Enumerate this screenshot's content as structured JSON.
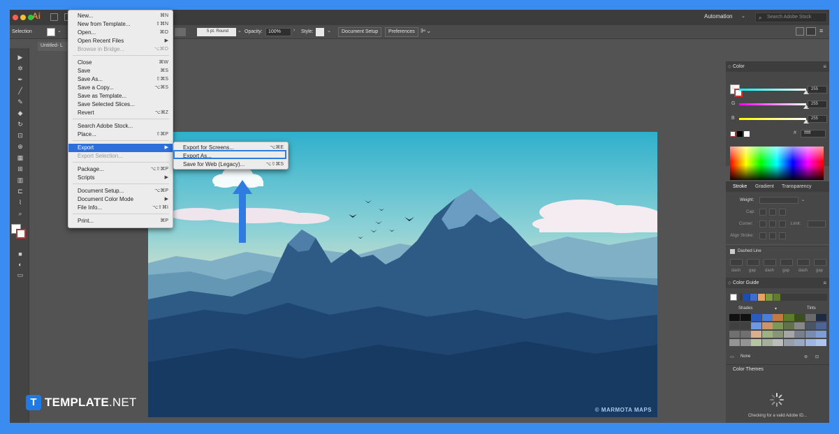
{
  "app": {
    "logo": "Ai",
    "workspace": "Automation",
    "search_placeholder": "Search Adobe Stock"
  },
  "control_bar": {
    "selection_label": "Selection",
    "brush": "5 pt. Round",
    "opacity_label": "Opacity:",
    "opacity_value": "100%",
    "style_label": "Style:",
    "document_setup": "Document Setup",
    "preferences": "Preferences"
  },
  "doc_tab": "Untitled- L",
  "file_menu": {
    "items": [
      {
        "label": "New...",
        "shortcut": "⌘N"
      },
      {
        "label": "New from Template...",
        "shortcut": "⇧⌘N"
      },
      {
        "label": "Open...",
        "shortcut": "⌘O"
      },
      {
        "label": "Open Recent Files",
        "shortcut": "▶"
      },
      {
        "label": "Browse in Bridge...",
        "shortcut": "⌥⌘O"
      },
      {
        "label": "Close",
        "shortcut": "⌘W"
      },
      {
        "label": "Save",
        "shortcut": "⌘S"
      },
      {
        "label": "Save As...",
        "shortcut": "⇧⌘S"
      },
      {
        "label": "Save a Copy...",
        "shortcut": "⌥⌘S"
      },
      {
        "label": "Save as Template...",
        "shortcut": ""
      },
      {
        "label": "Save Selected Slices...",
        "shortcut": ""
      },
      {
        "label": "Revert",
        "shortcut": "⌥⌘Z"
      },
      {
        "label": "Search Adobe Stock...",
        "shortcut": ""
      },
      {
        "label": "Place...",
        "shortcut": "⇧⌘P"
      },
      {
        "label": "Export",
        "shortcut": "▶"
      },
      {
        "label": "Export Selection...",
        "shortcut": ""
      },
      {
        "label": "Package...",
        "shortcut": "⌥⇧⌘P"
      },
      {
        "label": "Scripts",
        "shortcut": "▶"
      },
      {
        "label": "Document Setup...",
        "shortcut": "⌥⌘P"
      },
      {
        "label": "Document Color Mode",
        "shortcut": "▶"
      },
      {
        "label": "File Info...",
        "shortcut": "⌥⇧⌘I"
      },
      {
        "label": "Print...",
        "shortcut": "⌘P"
      }
    ]
  },
  "export_menu": {
    "items": [
      {
        "label": "Export for Screens...",
        "shortcut": "⌥⌘E"
      },
      {
        "label": "Export As...",
        "shortcut": ""
      },
      {
        "label": "Save for Web (Legacy)...",
        "shortcut": "⌥⇧⌘S"
      }
    ]
  },
  "artwork": {
    "watermark": "© MARMOTA MAPS"
  },
  "color_panel": {
    "title": "Color",
    "r_label": "R",
    "r_value": "255",
    "g_label": "G",
    "g_value": "255",
    "b_label": "B",
    "b_value": "255",
    "hex_label": "#",
    "hex_value": "ffffff"
  },
  "stroke_panel": {
    "tabs": [
      "Stroke",
      "Gradient",
      "Transparency"
    ],
    "weight_label": "Weight:",
    "cap_label": "Cap:",
    "corner_label": "Corner:",
    "limit_label": "Limit:",
    "align_label": "Align Stroke:",
    "dashed_label": "Dashed Line",
    "dash_labels": [
      "dash",
      "gap",
      "dash",
      "gap",
      "dash",
      "gap"
    ]
  },
  "color_guide": {
    "title": "Color Guide",
    "shades_label": "Shades",
    "tints_label": "Tints",
    "none_label": "None",
    "harmony_colors": [
      "#1a4fb0",
      "#3d6fd1",
      "#e8a265",
      "#7d9a3c",
      "#5f7d2a"
    ]
  },
  "color_themes": {
    "title": "Color Themes",
    "status": "Checking for a valid Adobe ID..."
  },
  "brand": {
    "name_bold": "TEMPLATE",
    "name_light": ".NET"
  }
}
